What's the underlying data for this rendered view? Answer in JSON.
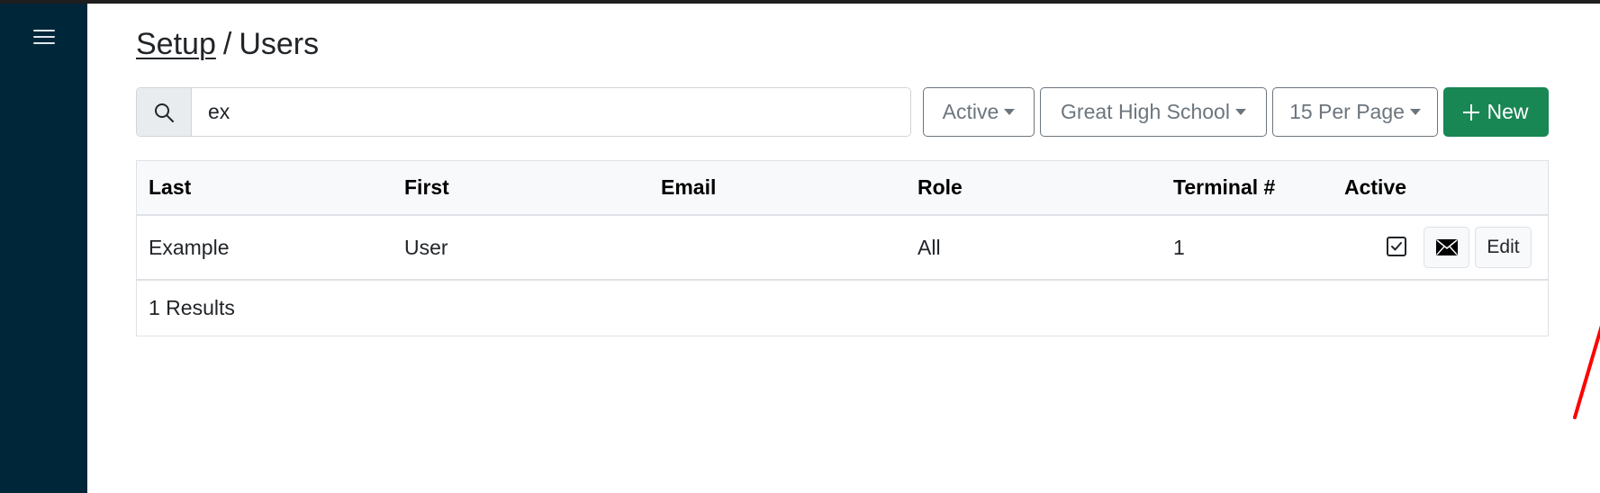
{
  "breadcrumb": {
    "parent": "Setup",
    "separator": "/",
    "current": "Users"
  },
  "search": {
    "value": "ex",
    "placeholder": "",
    "icon": "search-icon"
  },
  "filters": {
    "status": "Active",
    "school": "Great High School",
    "per_page": "15 Per Page"
  },
  "new_button": {
    "label": "New"
  },
  "table": {
    "columns": [
      "Last",
      "First",
      "Email",
      "Role",
      "Terminal #",
      "Active"
    ],
    "rows": [
      {
        "last": "Example",
        "first": "User",
        "email": "",
        "role": "All",
        "terminal": "1",
        "active": true,
        "edit_label": "Edit"
      }
    ],
    "footer": "1 Results"
  },
  "colors": {
    "sidebar": "#00263a",
    "primary_success": "#198754",
    "annotation_arrow": "#ff0000"
  }
}
